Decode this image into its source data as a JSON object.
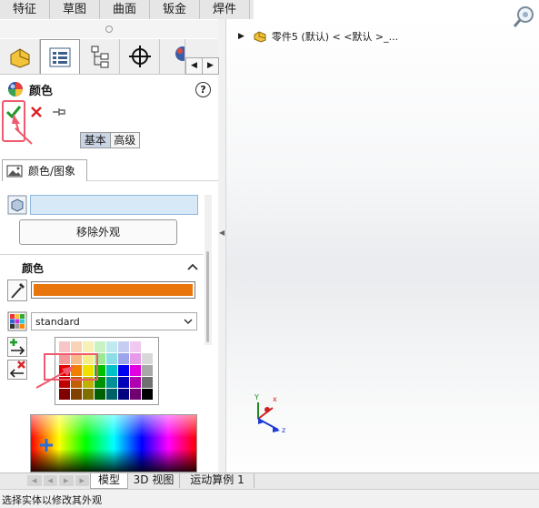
{
  "tabs": [
    "特征",
    "草图",
    "曲面",
    "钣金",
    "焊件"
  ],
  "panel": {
    "title": "颜色",
    "toggle": {
      "basic": "基本",
      "advanced": "高级"
    },
    "section_tab": "颜色/图象",
    "remove_button": "移除外观",
    "color_group": "颜色",
    "palette_value": "standard",
    "current_color": "#e8760c"
  },
  "tree": {
    "root_label": "零件5 (默认) < <默认 >_..."
  },
  "bottom_tabs": [
    "模型",
    "3D 视图",
    "运动算例 1"
  ],
  "status": "选择实体以修改其外观",
  "triad": {
    "x": "x",
    "y": "Y",
    "z": "z"
  },
  "swatches": [
    [
      "#f7c5c5",
      "#f7d3b8",
      "#f7f0b8",
      "#c9f2c4",
      "#bfe9ef",
      "#c6cdf2",
      "#efc9ef",
      "#ffffff"
    ],
    [
      "#f59a9a",
      "#f5b98a",
      "#f5ec8a",
      "#9be992",
      "#8ddde6",
      "#9aa5ec",
      "#e79ae8",
      "#d8d8d8"
    ],
    [
      "#e60000",
      "#f08000",
      "#f0e000",
      "#00c000",
      "#00c0c8",
      "#0000f0",
      "#e000e0",
      "#a8a8a8"
    ],
    [
      "#c00000",
      "#c06000",
      "#c0b000",
      "#009000",
      "#009098",
      "#0000b8",
      "#b000b0",
      "#707070"
    ],
    [
      "#800000",
      "#804000",
      "#807000",
      "#006000",
      "#006068",
      "#000080",
      "#700070",
      "#000000"
    ]
  ]
}
